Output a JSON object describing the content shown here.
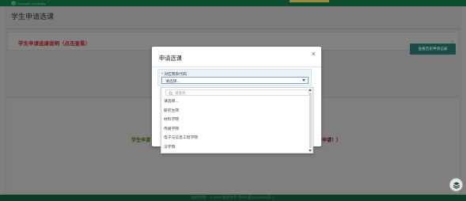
{
  "header": {
    "logo_text": "Graduate University"
  },
  "page": {
    "title": "学生申请选课"
  },
  "notice": {
    "link_text": "学生申请选课说明（点击查看）"
  },
  "history_button": {
    "label": "查看历史申请记录"
  },
  "content": {
    "left_fragment": "学生申请",
    "right_fragment": "申请！）"
  },
  "footer": {
    "text": "版权所有：© 2017 南京大学 苏ICP备10100451号-2"
  },
  "modal": {
    "title": "申请选课",
    "close_label": "×",
    "field": {
      "label": "对应院系代码",
      "required_mark": "*",
      "selected_value": "请选择..."
    },
    "dropdown": {
      "search_placeholder": "请查找",
      "options": [
        "请选择...",
        "研究生院",
        "材料学院",
        "传播学院",
        "电子与信息工程学院",
        "法学院"
      ]
    }
  },
  "colors": {
    "modal_bg": "#ffffff",
    "overlay": "#7f7f7f",
    "accent_button": "#1d4b47",
    "notice_link": "#7a1414",
    "topbar": "#0b4d2e",
    "select_border": "#7aa7c7"
  },
  "icons": [
    "close-icon",
    "chevron-right-icon",
    "chevron-down-icon",
    "search-icon",
    "layers-icon"
  ]
}
